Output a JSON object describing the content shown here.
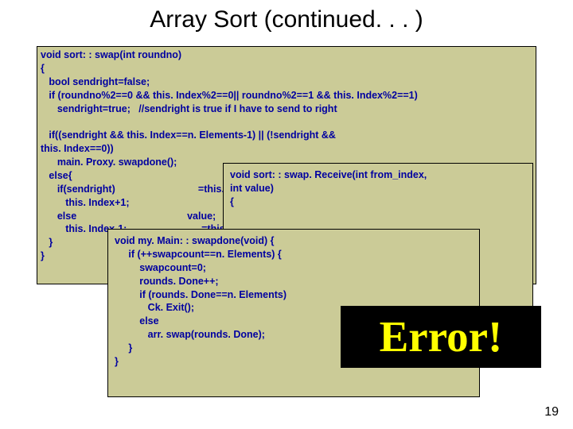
{
  "title": "Array Sort (continued. . . )",
  "code1": "void sort: : swap(int roundno)\n{\n   bool sendright=false;\n   if (roundno%2==0 && this. Index%2==0|| roundno%2==1 && this. Index%2==1)\n      sendright=true;   //sendright is true if I have to send to right\n\n   if((sendright && this. Index==n. Elements-1) || (!sendright &&\nthis. Index==0))\n      main. Proxy. swapdone();\n   else{\n      if(sendright)                              =this. Index-1 &&\n         this. Index+1;\n      else                                        value;\n         this. Index-1;                           =this. Index+1 &&\n   }\n}",
  "code2": "void sort: : swap. Receive(int from_index,\nint value)\n{\n\n\n\n                               value;\n",
  "code3": "void my. Main: : swapdone(void) {\n     if (++swapcount==n. Elements) {\n         swapcount=0;\n         rounds. Done++;\n         if (rounds. Done==n. Elements)\n            Ck. Exit();\n         else\n            arr. swap(rounds. Done);\n     }\n}",
  "error_label": "Error!",
  "page_number": "19"
}
